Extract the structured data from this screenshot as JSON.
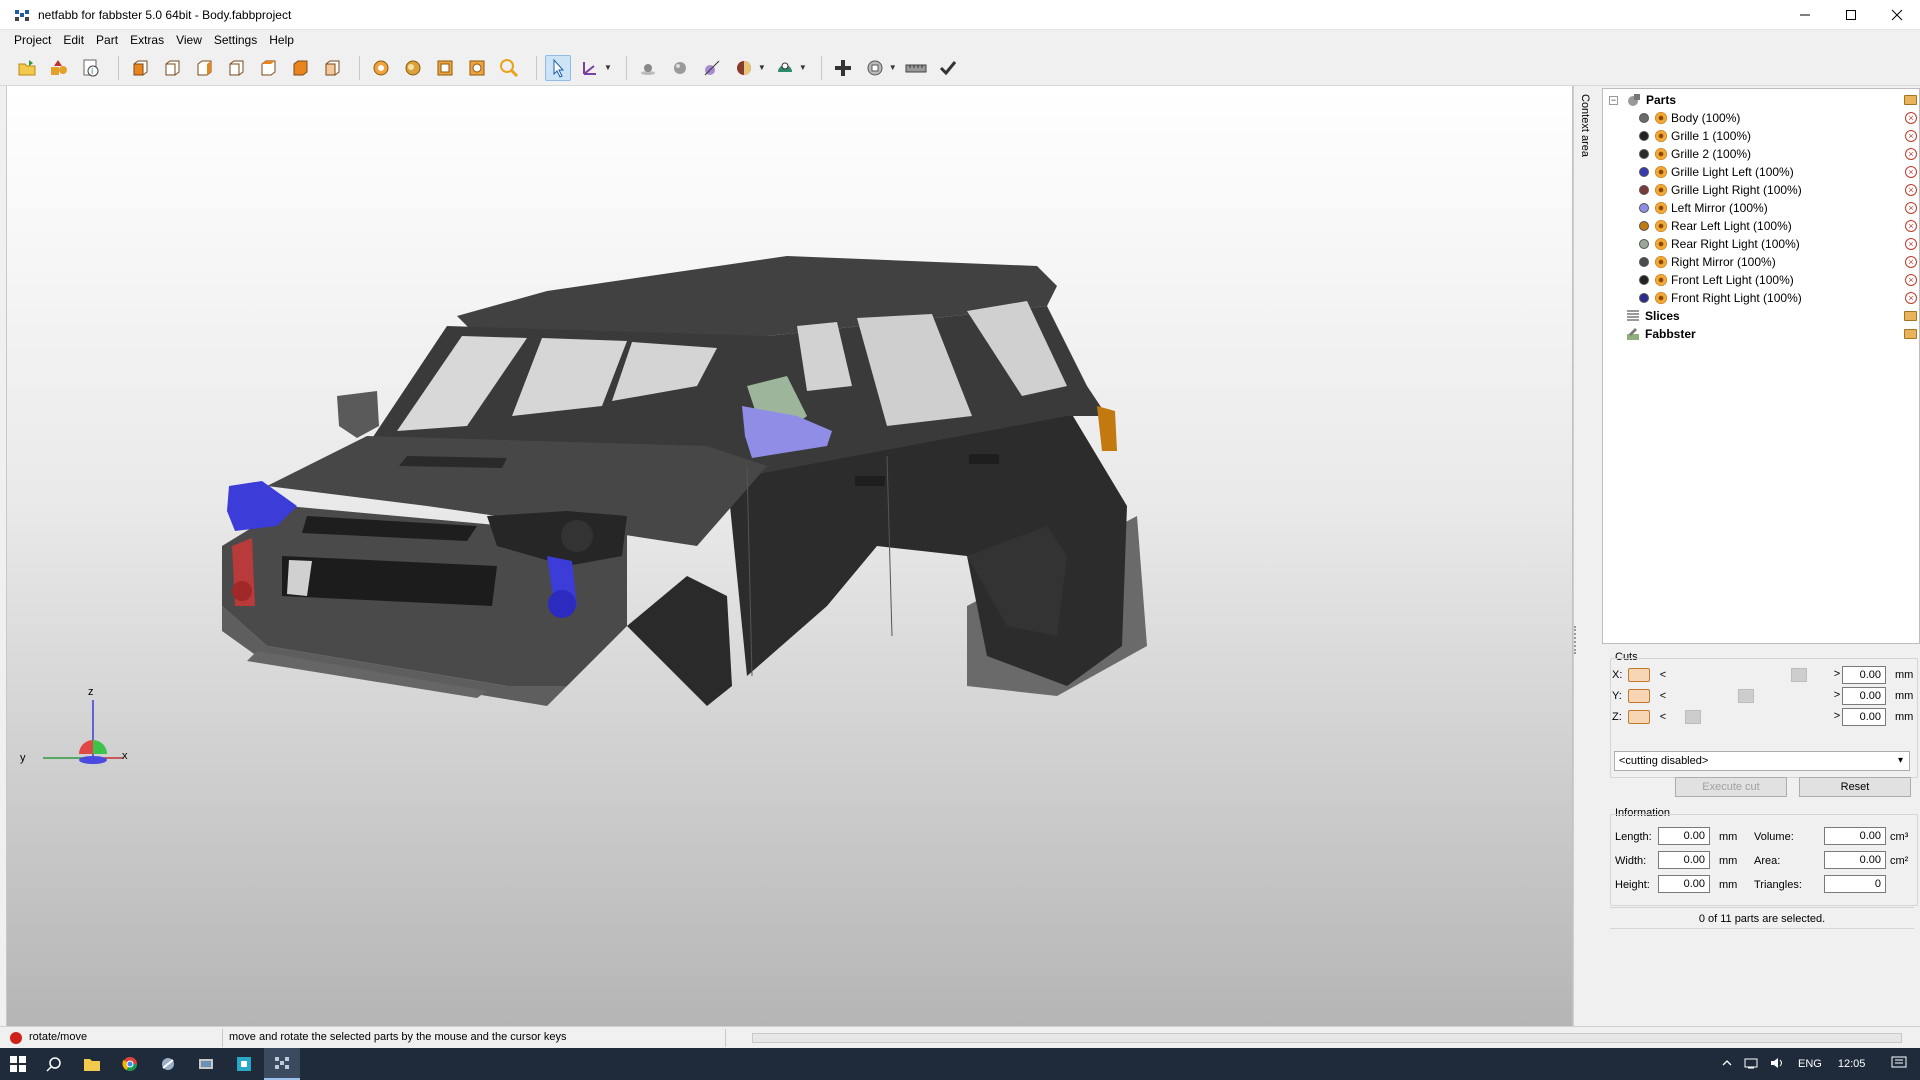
{
  "window": {
    "title": "netfabb for fabbster 5.0 64bit - Body.fabbproject",
    "controls": [
      "minimize",
      "maximize",
      "close"
    ]
  },
  "menu": [
    "Project",
    "Edit",
    "Part",
    "Extras",
    "View",
    "Settings",
    "Help"
  ],
  "toolbar": {
    "icons": [
      "open-project-icon",
      "add-part-icon",
      "project-info-icon",
      "view-front-icon",
      "view-back-icon",
      "view-left-icon",
      "view-right-icon",
      "view-top-icon",
      "view-bottom-icon",
      "view-iso-icon",
      "zoom-selection-icon",
      "zoom-all-icon",
      "zoom-platform-icon",
      "zoom-part-icon",
      "zoom-magnifier-icon",
      "select-arrow-icon",
      "axis-tool-icon",
      "point-tool-icon",
      "sphere-tool-icon",
      "measure-tool-icon",
      "shading-icon",
      "color-mode-icon",
      "add-icon",
      "repair-icon",
      "ruler-icon",
      "checkmark-icon"
    ]
  },
  "viewport": {
    "axis_labels": {
      "z": "z",
      "y": "y",
      "x": "x"
    },
    "colors": {
      "body": "#3e3e3e",
      "blue_parts": "#3c3cd8",
      "red_parts": "#b83a3a",
      "orange_light": "#c27a10",
      "mirror": "#8f8de6"
    }
  },
  "content_area_label": "Context area",
  "tree": {
    "parts_label": "Parts",
    "items": [
      {
        "label": "Body (100%)",
        "color": "#6b6b6b"
      },
      {
        "label": "Grille 1 (100%)",
        "color": "#222222"
      },
      {
        "label": "Grille 2 (100%)",
        "color": "#2a2a2a"
      },
      {
        "label": "Grille Light Left (100%)",
        "color": "#3a3ab0"
      },
      {
        "label": "Grille Light Right (100%)",
        "color": "#7a3a3a"
      },
      {
        "label": "Left Mirror (100%)",
        "color": "#8f8de6"
      },
      {
        "label": "Rear Left Light (100%)",
        "color": "#c27a10"
      },
      {
        "label": "Rear Right Light (100%)",
        "color": "#9aa89a"
      },
      {
        "label": "Right Mirror (100%)",
        "color": "#4b4b4b"
      },
      {
        "label": "Front Left Light (100%)",
        "color": "#222222"
      },
      {
        "label": "Front Right Light (100%)",
        "color": "#2c2c8c"
      }
    ],
    "slices_label": "Slices",
    "fabbster_label": "Fabbster"
  },
  "cuts": {
    "title": "Cuts",
    "rows": [
      {
        "axis": "X:",
        "value": "0.00",
        "unit": "mm",
        "thumb": 0.9
      },
      {
        "axis": "Y:",
        "value": "0.00",
        "unit": "mm",
        "thumb": 0.5
      },
      {
        "axis": "Z:",
        "value": "0.00",
        "unit": "mm",
        "thumb": 0.1
      }
    ],
    "mode": "<cutting disabled>",
    "execute_label": "Execute cut",
    "reset_label": "Reset"
  },
  "information": {
    "title": "Information",
    "length_label": "Length:",
    "length_value": "0.00",
    "length_unit": "mm",
    "width_label": "Width:",
    "width_value": "0.00",
    "width_unit": "mm",
    "height_label": "Height:",
    "height_value": "0.00",
    "height_unit": "mm",
    "volume_label": "Volume:",
    "volume_value": "0.00",
    "volume_unit": "cm³",
    "area_label": "Area:",
    "area_value": "0.00",
    "area_unit": "cm²",
    "triangles_label": "Triangles:",
    "triangles_value": "0",
    "selection_status": "0 of 11 parts are selected."
  },
  "statusbar": {
    "mode": "rotate/move",
    "hint": "move and rotate the selected parts by the mouse and the cursor keys"
  },
  "taskbar": {
    "apps": [
      "start-icon",
      "search-icon",
      "file-explorer-icon",
      "chrome-icon",
      "app-icon",
      "app2-icon",
      "app3-icon",
      "netfabb-icon"
    ],
    "language": "ENG",
    "time": "12:05"
  }
}
